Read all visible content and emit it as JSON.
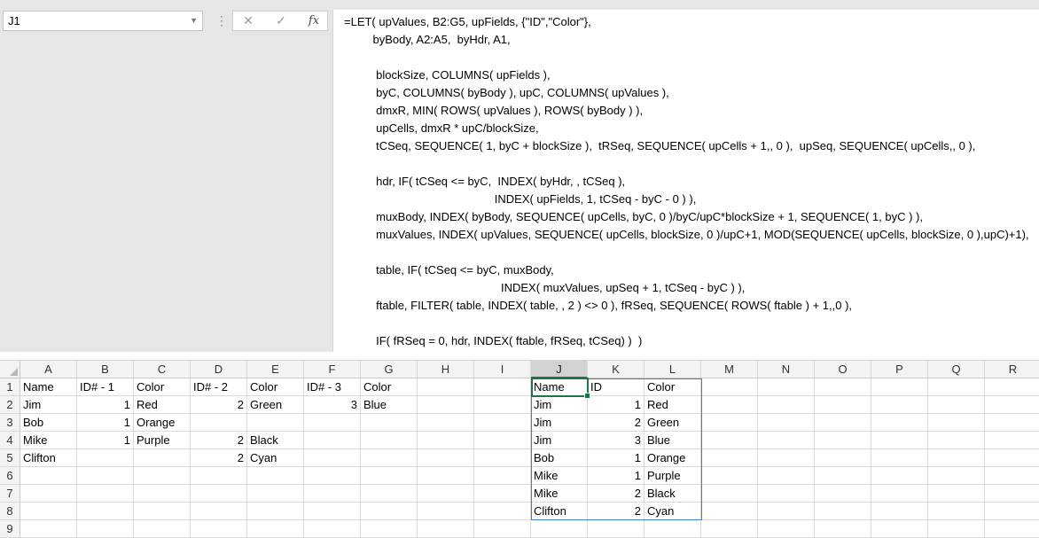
{
  "name_box": {
    "value": "J1"
  },
  "formula_bar": {
    "cancel_icon": "✕",
    "enter_icon": "✓",
    "fx_label": "fx",
    "lines": [
      "=LET( upValues, B2:G5, upFields, {\"ID\",\"Color\"},",
      "         byBody, A2:A5,  byHdr, A1,",
      "",
      "          blockSize, COLUMNS( upFields ),",
      "          byC, COLUMNS( byBody ), upC, COLUMNS( upValues ),",
      "          dmxR, MIN( ROWS( upValues ), ROWS( byBody ) ),",
      "          upCells, dmxR * upC/blockSize,",
      "          tCSeq, SEQUENCE( 1, byC + blockSize ),  tRSeq, SEQUENCE( upCells + 1,, 0 ),  upSeq, SEQUENCE( upCells,, 0 ),",
      "",
      "          hdr, IF( tCSeq <= byC,  INDEX( byHdr, , tCSeq ),",
      "                                               INDEX( upFields, 1, tCSeq - byC - 0 ) ),",
      "          muxBody, INDEX( byBody, SEQUENCE( upCells, byC, 0 )/byC/upC*blockSize + 1, SEQUENCE( 1, byC ) ),",
      "          muxValues, INDEX( upValues, SEQUENCE( upCells, blockSize, 0 )/upC+1, MOD(SEQUENCE( upCells, blockSize, 0 ),upC)+1),",
      "",
      "          table, IF( tCSeq <= byC, muxBody,",
      "                                                 INDEX( muxValues, upSeq + 1, tCSeq - byC ) ),",
      "          ftable, FILTER( table, INDEX( table, , 2 ) <> 0 ), fRSeq, SEQUENCE( ROWS( ftable ) + 1,,0 ),",
      "",
      "          IF( fRSeq = 0, hdr, INDEX( ftable, fRSeq, tCSeq) )  )"
    ]
  },
  "columns": [
    "A",
    "B",
    "C",
    "D",
    "E",
    "F",
    "G",
    "H",
    "I",
    "J",
    "K",
    "L",
    "M",
    "N",
    "O",
    "P",
    "Q",
    "R"
  ],
  "selected_column": "J",
  "rows": [
    "1",
    "2",
    "3",
    "4",
    "5",
    "6",
    "7",
    "8",
    "9"
  ],
  "cells": {
    "A1": "Name",
    "B1": "ID# - 1",
    "C1": "Color",
    "D1": "ID# - 2",
    "E1": "Color",
    "F1": "ID# - 3",
    "G1": "Color",
    "A2": "Jim",
    "B2": "1",
    "C2": "Red",
    "D2": "2",
    "E2": "Green",
    "F2": "3",
    "G2": "Blue",
    "A3": "Bob",
    "B3": "1",
    "C3": "Orange",
    "A4": "Mike",
    "B4": "1",
    "C4": "Purple",
    "D4": "2",
    "E4": "Black",
    "A5": "Clifton",
    "D5": "2",
    "E5": "Cyan",
    "J1": "Name",
    "K1": "ID",
    "L1": "Color",
    "J2": "Jim",
    "K2": "1",
    "L2": "Red",
    "J3": "Jim",
    "K3": "2",
    "L3": "Green",
    "J4": "Jim",
    "K4": "3",
    "L4": "Blue",
    "J5": "Bob",
    "K5": "1",
    "L5": "Orange",
    "J6": "Mike",
    "K6": "1",
    "L6": "Purple",
    "J7": "Mike",
    "K7": "2",
    "L7": "Black",
    "J8": "Clifton",
    "K8": "2",
    "L8": "Cyan"
  },
  "numeric_cells": [
    "B2",
    "B3",
    "B4",
    "D2",
    "D4",
    "D5",
    "F2",
    "K2",
    "K3",
    "K4",
    "K5",
    "K6",
    "K7",
    "K8"
  ],
  "colors": {
    "accent": "#217346",
    "spill_border": "#3c7fd4"
  }
}
